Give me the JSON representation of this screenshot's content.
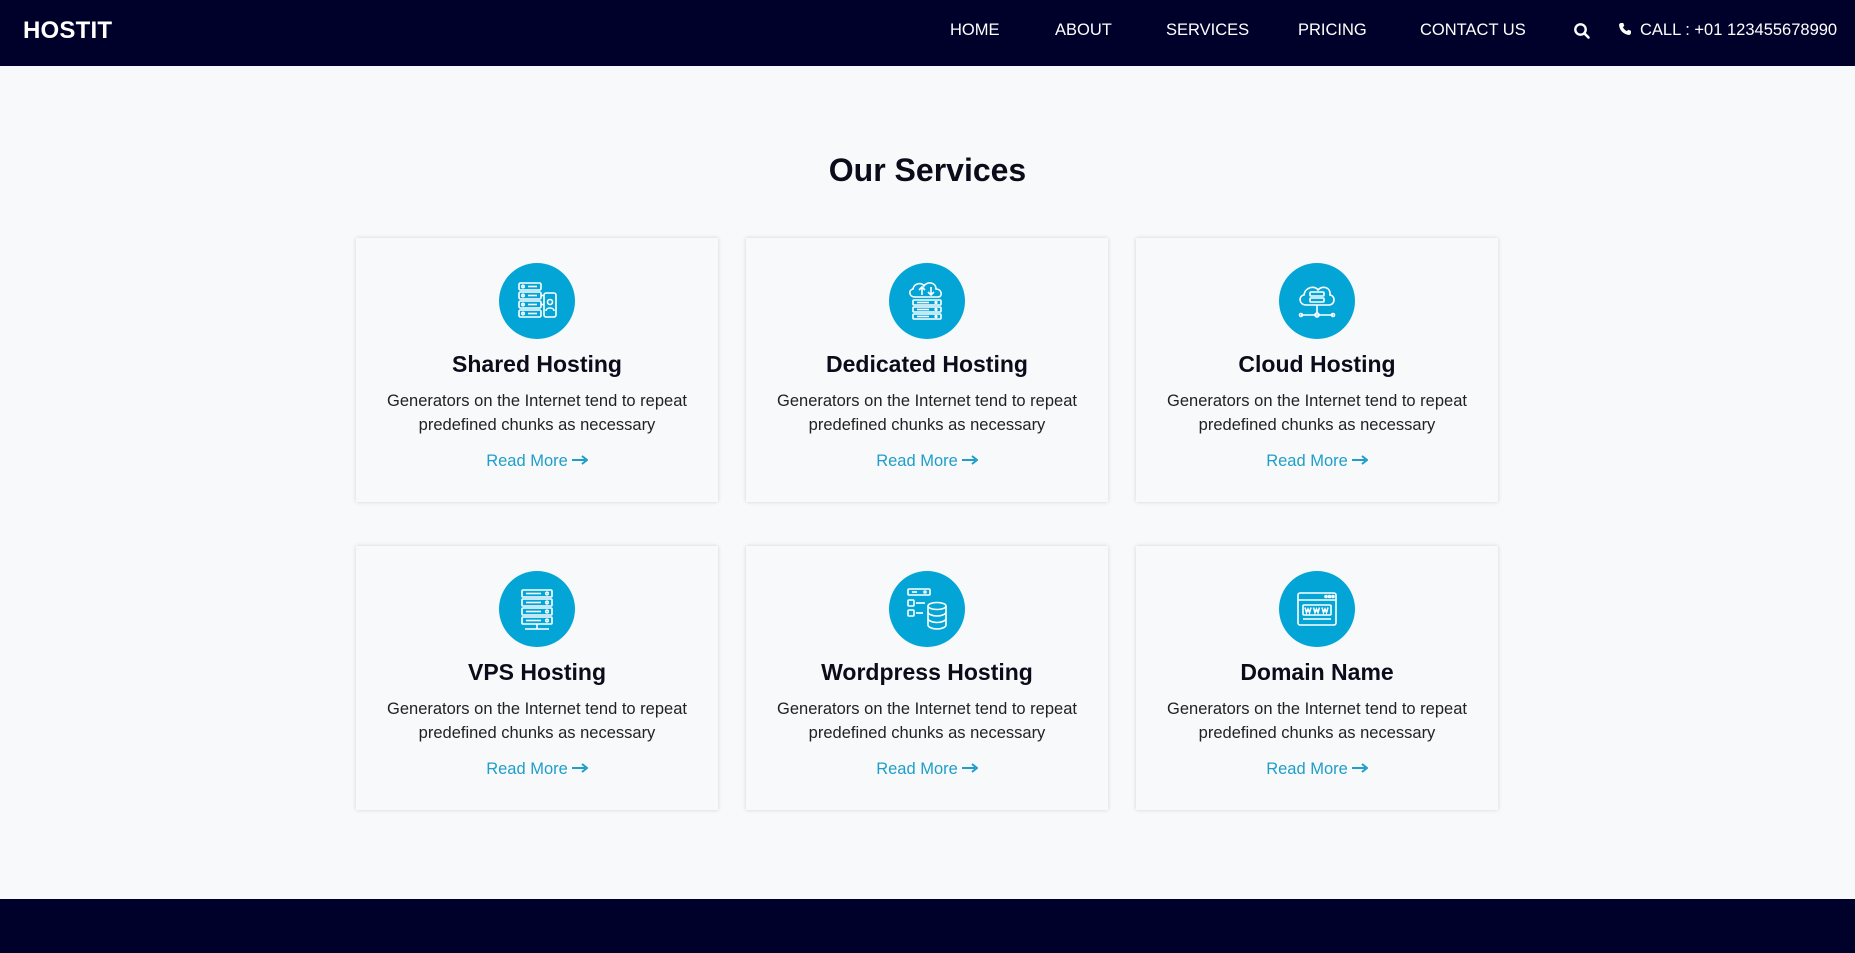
{
  "header": {
    "brand": "HOSTIT",
    "nav": [
      "HOME",
      "ABOUT",
      "SERVICES",
      "PRICING",
      "CONTACT US"
    ],
    "search_icon": "search-icon",
    "call_text": "CALL : +01 123455678990",
    "call_icon": "phone-icon"
  },
  "services": {
    "title": "Our Services",
    "cards": [
      {
        "title": "Shared Hosting",
        "desc": "Generators on the Internet tend to repeat predefined chunks as necessary",
        "link": "Read More",
        "icon": "shared-hosting-icon"
      },
      {
        "title": "Dedicated Hosting",
        "desc": "Generators on the Internet tend to repeat predefined chunks as necessary",
        "link": "Read More",
        "icon": "dedicated-hosting-icon"
      },
      {
        "title": "Cloud Hosting",
        "desc": "Generators on the Internet tend to repeat predefined chunks as necessary",
        "link": "Read More",
        "icon": "cloud-hosting-icon"
      },
      {
        "title": "VPS Hosting",
        "desc": "Generators on the Internet tend to repeat predefined chunks as necessary",
        "link": "Read More",
        "icon": "vps-hosting-icon"
      },
      {
        "title": "Wordpress Hosting",
        "desc": "Generators on the Internet tend to repeat predefined chunks as necessary",
        "link": "Read More",
        "icon": "wordpress-hosting-icon"
      },
      {
        "title": "Domain Name",
        "desc": "Generators on the Internet tend to repeat predefined chunks as necessary",
        "link": "Read More",
        "icon": "domain-name-icon"
      }
    ]
  },
  "colors": {
    "navbar_bg": "#00012a",
    "accent": "#03a5d6",
    "link": "#1e9ec9",
    "page_bg": "#f8f9fa"
  }
}
